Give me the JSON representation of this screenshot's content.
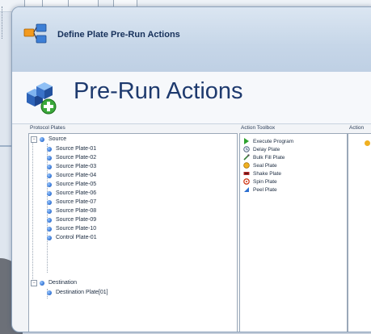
{
  "window": {
    "title": "Define Plate Pre-Run Actions"
  },
  "header": {
    "title": "Pre-Run Actions"
  },
  "panels": {
    "protocol_plates_label": "Protocol Plates",
    "action_toolbox_label": "Action Toolbox",
    "action_label": "Action"
  },
  "tree": {
    "source": {
      "label": "Source",
      "children": [
        "Source Plate-01",
        "Source Plate-02",
        "Source Plate-03",
        "Source Plate-04",
        "Source Plate-05",
        "Source Plate-06",
        "Source Plate-07",
        "Source Plate-08",
        "Source Plate-09",
        "Source Plate-10",
        "Control Plate-01"
      ]
    },
    "destination": {
      "label": "Destination",
      "children": [
        "Destination Plate[01]"
      ]
    }
  },
  "actions": [
    {
      "label": "Execute Program",
      "icon": "play-icon"
    },
    {
      "label": "Delay Plate",
      "icon": "clock-icon"
    },
    {
      "label": "Bulk Fill Plate",
      "icon": "dropper-icon"
    },
    {
      "label": "Seal Plate",
      "icon": "seal-icon"
    },
    {
      "label": "Shake Plate",
      "icon": "shake-icon"
    },
    {
      "label": "Spin Plate",
      "icon": "spin-icon"
    },
    {
      "label": "Peel Plate",
      "icon": "peel-icon"
    }
  ],
  "colors": {
    "header_text": "#1e3a6e",
    "title_text": "#16305a",
    "tree_node": "#2e6fd0"
  }
}
